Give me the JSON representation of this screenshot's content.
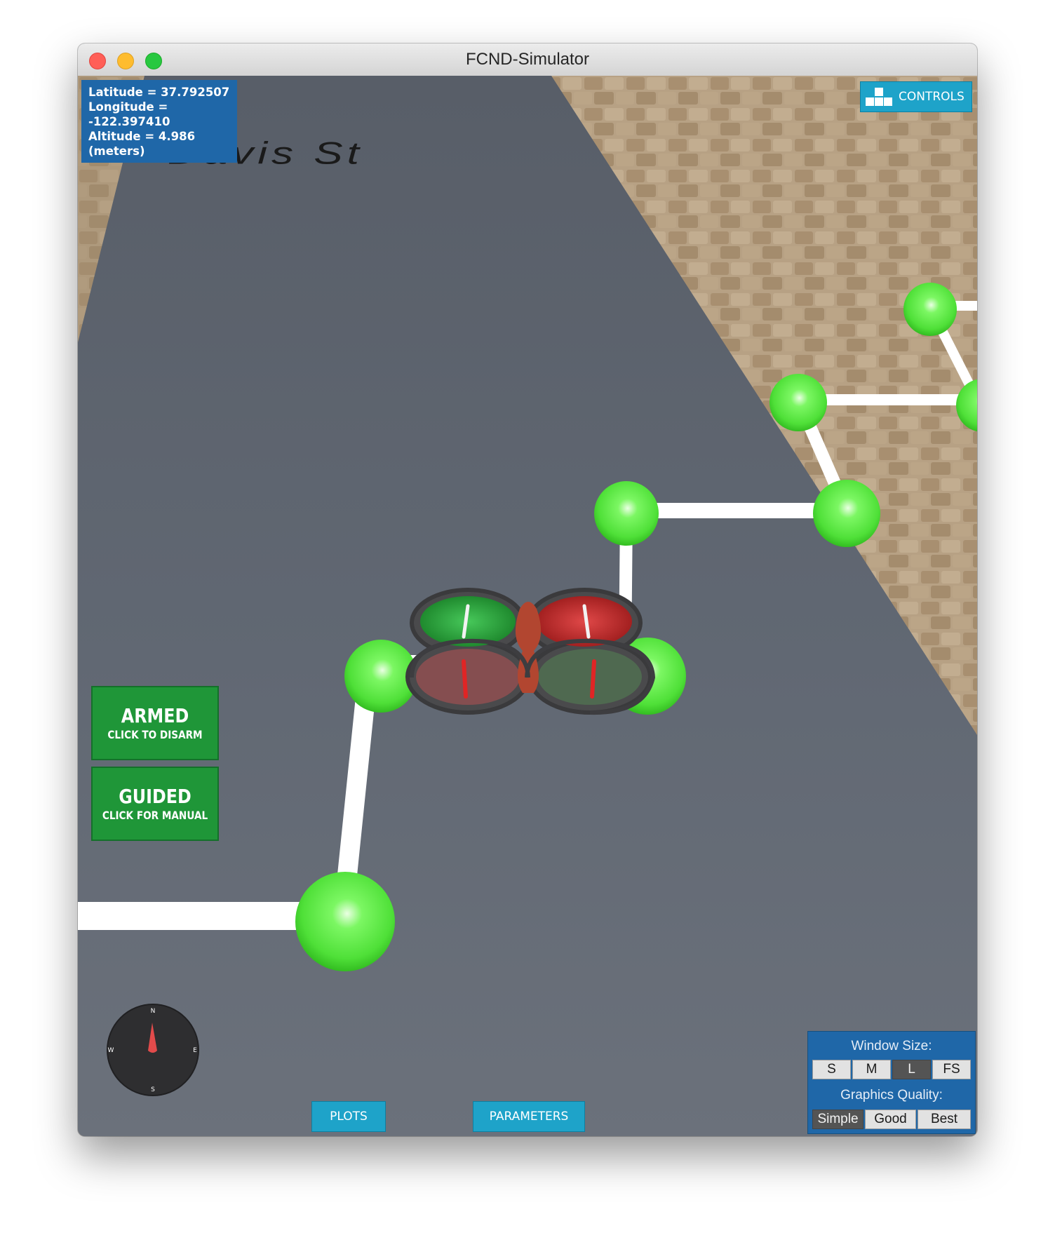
{
  "window": {
    "title": "FCND-Simulator"
  },
  "scene": {
    "street_name": "Davis St"
  },
  "telemetry": {
    "latitude": "Latitude = 37.792507",
    "longitude": "Longitude = -122.397410",
    "altitude": "Altitude = 4.986 (meters)"
  },
  "toolbar": {
    "controls_label": "CONTROLS"
  },
  "mode_buttons": {
    "armed": {
      "title": "ARMED",
      "subtitle": "CLICK TO DISARM"
    },
    "guided": {
      "title": "GUIDED",
      "subtitle": "CLICK FOR MANUAL"
    }
  },
  "compass": {
    "n": "N",
    "e": "E",
    "s": "S",
    "w": "W"
  },
  "bottom_buttons": {
    "plots": "PLOTS",
    "parameters": "PARAMETERS"
  },
  "settings": {
    "window_size_label": "Window Size:",
    "window_sizes": [
      "S",
      "M",
      "L",
      "FS"
    ],
    "window_size_selected": "L",
    "graphics_quality_label": "Graphics Quality:",
    "graphics_qualities": [
      "Simple",
      "Good",
      "Best"
    ],
    "graphics_quality_selected": "Simple"
  },
  "colors": {
    "panel_blue": "#1f67a8",
    "button_cyan": "#1ea3c9",
    "mode_green": "#1f9638",
    "waypoint_green": "#5fe845",
    "road_gray": "#5e6570"
  }
}
